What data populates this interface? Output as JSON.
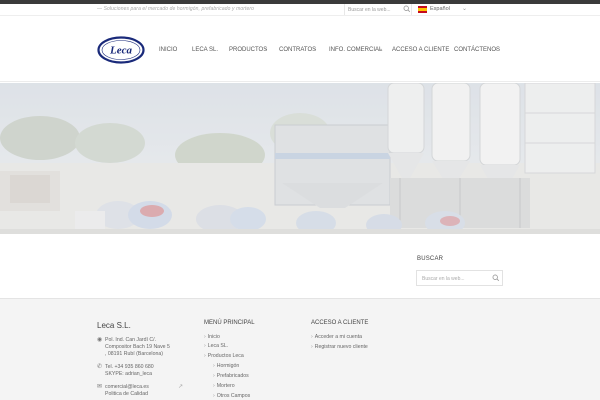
{
  "topbar": {
    "tagline": "— Soluciones para el mercado de hormigón, prefabricado y mortero",
    "search_placeholder": "Buscar en la web...",
    "search_icon": "magnifier-icon",
    "language": {
      "label": "Español",
      "flag_icon": "spain-flag-icon"
    }
  },
  "header": {
    "logo_text": "Leca",
    "nav": [
      {
        "label": "Inicio",
        "has_dropdown": false
      },
      {
        "label": "Leca SL.",
        "has_dropdown": false
      },
      {
        "label": "Productos",
        "has_dropdown": true
      },
      {
        "label": "Contratos",
        "has_dropdown": true
      },
      {
        "label": "Info. Comercial",
        "has_dropdown": true
      },
      {
        "label": "Acceso a Cliente",
        "has_dropdown": false
      },
      {
        "label": "Contáctenos",
        "has_dropdown": true
      }
    ]
  },
  "sidebar": {
    "search_title": "Buscar",
    "search_placeholder": "Buscar en la web..."
  },
  "footer": {
    "company": {
      "name": "Leca S.L.",
      "address": [
        "Pol. Ind. Can Jardí C/.",
        "Compositor Bach 19 Nave 5",
        ", 08191 Rubí (Barcelona)"
      ],
      "phone": "Tel. +34 935 860 680",
      "skype": "SKYPE: adrian_leca",
      "email": "comercial@leca.es",
      "extra": "Politica de Calidad"
    },
    "menu": {
      "title": "Menú Principal",
      "items": [
        "Inicio",
        "Leca SL.",
        "Productos Leca"
      ],
      "subitems": [
        "Hormigón",
        "Prefabricados",
        "Mortero",
        "Otros Campos"
      ]
    },
    "access": {
      "title": "Acceso a cliente",
      "items": [
        "Acceder a mi cuenta",
        "Registrar nuevo cliente"
      ]
    }
  },
  "colors": {
    "topline": "#3a3a3a",
    "logo_navy": "#1a2a7a",
    "footer_bg": "#f4f4f4"
  }
}
